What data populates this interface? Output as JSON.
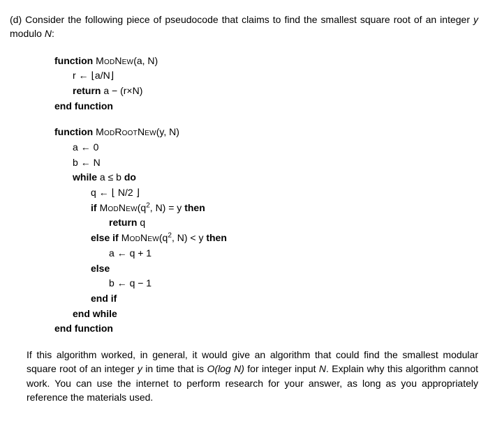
{
  "part_label": "(d)",
  "intro_pre": "Consider the following piece of pseudocode that claims to find the smallest square root of an integer ",
  "intro_y": "y",
  "intro_mid": " modulo ",
  "intro_N": "N",
  "intro_end": ":",
  "fn1": {
    "sig_kw": "function",
    "sig_name": "ModNew",
    "sig_args": "(a, N)",
    "l1_pre": "r ← ⌊a/N⌋",
    "l2_kw": "return",
    "l2_rest": " a − (r×N)",
    "end": "end function"
  },
  "fn2": {
    "sig_kw": "function",
    "sig_name": "ModRootNew",
    "sig_args": "(y, N)",
    "l1": "a ← 0",
    "l2": "b ← N",
    "while_kw1": "while",
    "while_cond": " a ≤ b ",
    "while_kw2": "do",
    "l4": "q ← ⌊ N/2 ⌋",
    "if_kw": "if",
    "if_name": " ModNew",
    "if_args_pre": "(q",
    "if_sup": "2",
    "if_args_post": ", N) = y ",
    "then_kw": "then",
    "ret_kw": "return",
    "ret_rest": " q",
    "elseif_kw": "else if",
    "elseif_name": " ModNew",
    "elseif_args_pre": "(q",
    "elseif_sup": "2",
    "elseif_args_post": ", N) < y ",
    "elseif_then": "then",
    "l_aq": "a ← q + 1",
    "else_kw": "else",
    "l_bq": "b ← q − 1",
    "endif": "end if",
    "endwhile": "end while",
    "endfn": "end function"
  },
  "closing": {
    "p1": "If this algorithm worked, in general, it would give an algorithm that could find the smallest modular square root of an integer ",
    "y": "y",
    "p2": " in time that is ",
    "olog": "O(log N)",
    "p3": " for integer input ",
    "N": "N",
    "p4": ". Explain why this algorithm cannot work. You can use the internet to perform research for your answer, as long as you appropriately reference the materials used."
  }
}
